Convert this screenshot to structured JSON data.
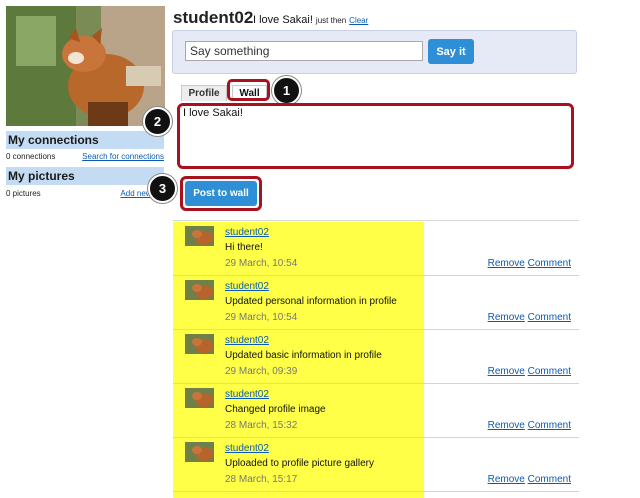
{
  "profile": {
    "name": "student02",
    "status_text": "I love Sakai!",
    "status_time": "just then",
    "clear_label": "Clear"
  },
  "sidebar": {
    "connections": {
      "heading": "My connections",
      "count": "0 connections",
      "action": "Search for connections"
    },
    "pictures": {
      "heading": "My pictures",
      "count": "0 pictures",
      "action": "Add new pic"
    }
  },
  "status_form": {
    "placeholder": "Say something",
    "button": "Say it"
  },
  "tabs": [
    {
      "label": "Profile",
      "active": false
    },
    {
      "label": "Wall",
      "active": true
    }
  ],
  "wall_form": {
    "text": "I love Sakai!",
    "button": "Post to wall"
  },
  "callouts": [
    "1",
    "2",
    "3"
  ],
  "wall_posts": [
    {
      "author": "student02",
      "message": "Hi there!",
      "date": "29 March, 10:54",
      "remove": "Remove",
      "comment": "Comment"
    },
    {
      "author": "student02",
      "message": "Updated personal information in profile",
      "date": "29 March, 10:54",
      "remove": "Remove",
      "comment": "Comment"
    },
    {
      "author": "student02",
      "message": "Updated basic information in profile",
      "date": "29 March, 09:39",
      "remove": "Remove",
      "comment": "Comment"
    },
    {
      "author": "student02",
      "message": "Changed profile image",
      "date": "28 March, 15:32",
      "remove": "Remove",
      "comment": "Comment"
    },
    {
      "author": "student02",
      "message": "Uploaded to profile picture gallery",
      "date": "28 March, 15:17",
      "remove": "Remove",
      "comment": "Comment"
    }
  ],
  "colors": {
    "accent": "#2e8fd6",
    "highlight_red": "#a8121e",
    "feed_highlight": "#ffff47",
    "section_blue": "#c3dcf4"
  }
}
